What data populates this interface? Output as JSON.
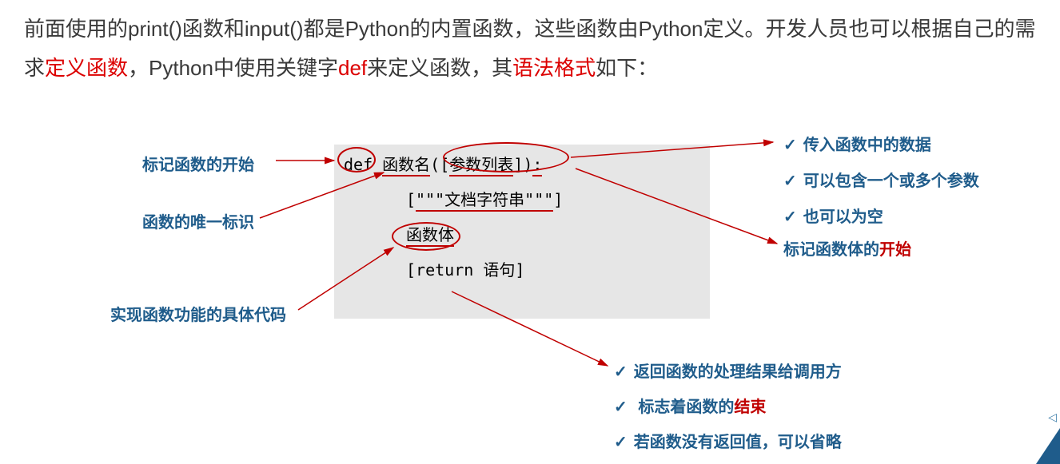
{
  "intro": {
    "text1a": "前面使用的print()函数和input()都是Python的内置函数，这些函数由Python定义。开发人员也可以根据自己的需求",
    "red1": "定义函数",
    "text1b": "，Python中使用关键字",
    "red2": "def",
    "text1c": "来定义函数，其",
    "red3": "语法格式",
    "text1d": "如下："
  },
  "code": {
    "def": "def",
    "funcname": "函数名",
    "lp": "(",
    "lb": "[",
    "params": "参数列表",
    "rb": "]",
    "rp": ")",
    "colon": ":",
    "doc_l": "[",
    "doc_q1": "\"\"\"",
    "doc_txt": "文档字符串",
    "doc_q2": "\"\"\"",
    "doc_r": "]",
    "body": "函数体",
    "ret_l": "[",
    "ret_kw": "return",
    "ret_txt": " 语句",
    "ret_r": "]"
  },
  "annotations": {
    "a1": "标记函数的开始",
    "a2": "函数的唯一标识",
    "a3": "实现函数功能的具体代码"
  },
  "checks_right": {
    "c1": "传入函数中的数据",
    "c2": "可以包含一个或多个参数",
    "c3": "也可以为空"
  },
  "mark_body_start": {
    "pre": "标记函数体的",
    "red": "开始"
  },
  "checks_bottom": {
    "b1": "返回函数的处理结果给调用方",
    "b2_pre": "标志着函数的",
    "b2_red": "结束",
    "b3": "若函数没有返回值，可以省略"
  }
}
